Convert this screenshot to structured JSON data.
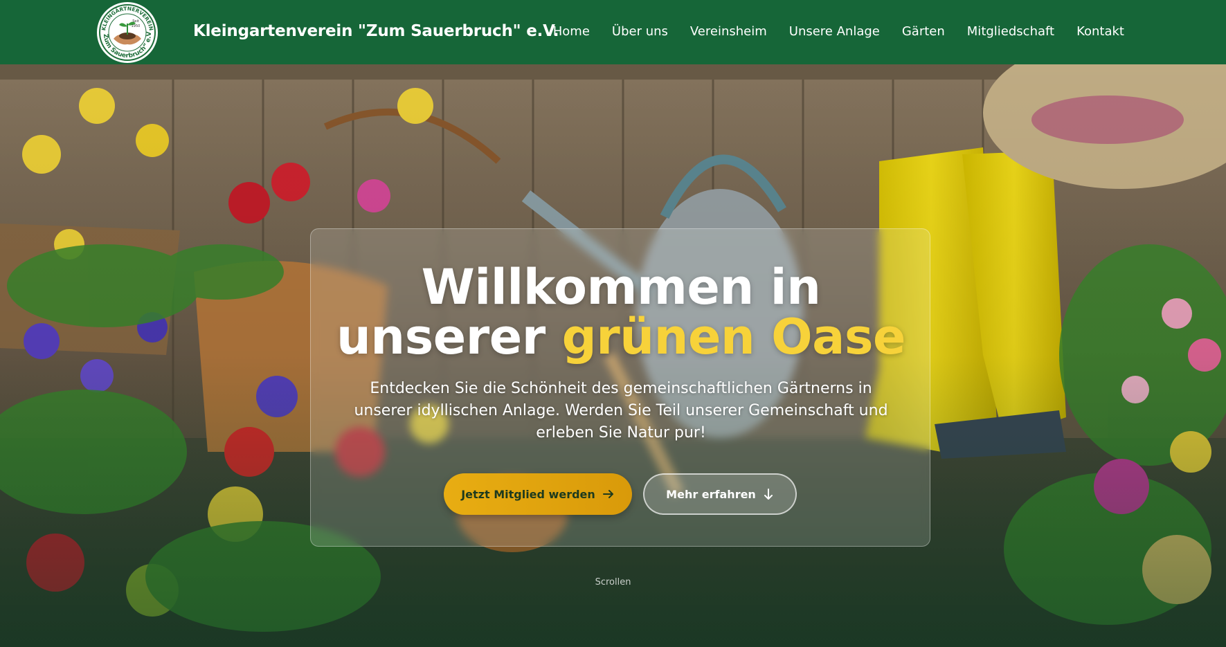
{
  "header": {
    "logo": {
      "top_text": "KLEINGÄRTNERVEREIN",
      "bottom_text": "„Zum Sauerbruch“ e.V.",
      "seit": "Seit",
      "year": "1950"
    },
    "site_title": "Kleingartenverein \"Zum Sauerbruch\" e.V.",
    "nav": [
      "Home",
      "Über uns",
      "Vereinsheim",
      "Unsere Anlage",
      "Gärten",
      "Mitgliedschaft",
      "Kontakt"
    ]
  },
  "hero": {
    "headline_line1": "Willkommen in",
    "headline_prefix": "unserer",
    "headline_accent": "grünen Oase",
    "subtext": "Entdecken Sie die Schönheit des gemeinschaftlichen Gärtnerns in unserer idyllischen Anlage. Werden Sie Teil unserer Gemeinschaft und erleben Sie Natur pur!",
    "primary_button": "Jetzt Mitglied werden",
    "secondary_button": "Mehr erfahren",
    "scroll_hint": "Scrollen"
  },
  "colors": {
    "header_bg": "#166638",
    "accent_yellow": "#f7d23a",
    "button_gold": "#e8ad12"
  },
  "icons": {
    "primary_button_icon": "arrow-right-icon",
    "secondary_button_icon": "arrow-down-icon"
  }
}
